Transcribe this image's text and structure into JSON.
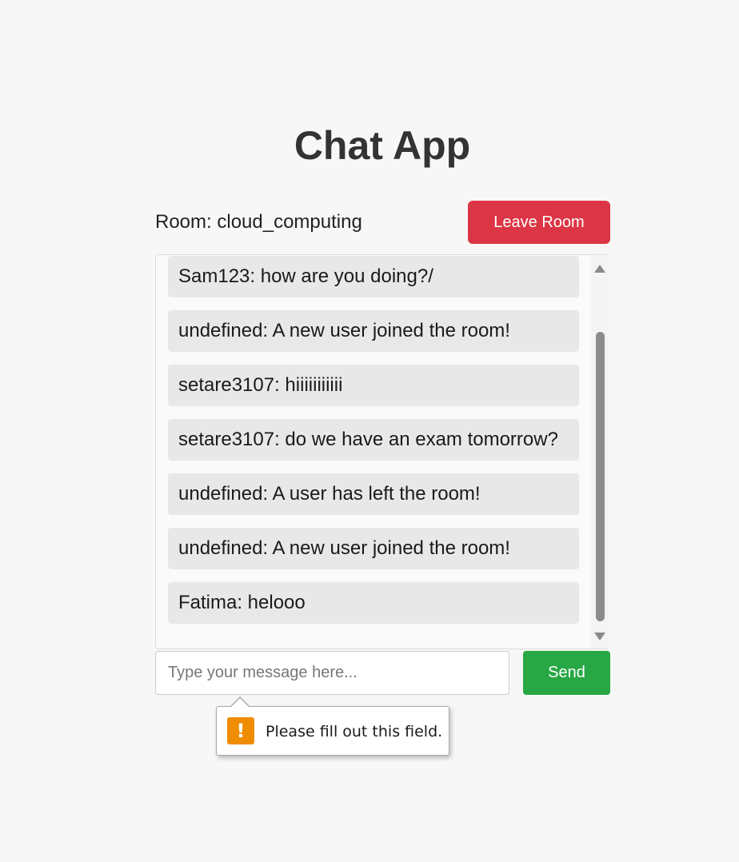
{
  "header": {
    "title": "Chat App"
  },
  "room": {
    "label": "Room: cloud_computing",
    "leave_button_label": "Leave Room"
  },
  "messages": [
    {
      "text": "Sam123: how are you doing?/"
    },
    {
      "text": "undefined: A new user joined the room!"
    },
    {
      "text": "setare3107: hiiiiiiiiiii"
    },
    {
      "text": "setare3107: do we have an exam tomorrow?"
    },
    {
      "text": "undefined: A user has left the room!"
    },
    {
      "text": "undefined: A new user joined the room!"
    },
    {
      "text": "Fatima: helooo"
    }
  ],
  "composer": {
    "placeholder": "Type your message here...",
    "value": "",
    "send_label": "Send"
  },
  "validation_tooltip": {
    "icon": "warning-icon",
    "icon_glyph": "!",
    "text": "Please fill out this field."
  },
  "colors": {
    "leave_button": "#dc3545",
    "send_button": "#28a745",
    "warning_icon": "#f08c00"
  }
}
